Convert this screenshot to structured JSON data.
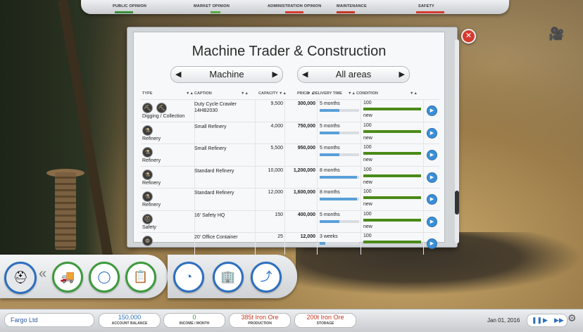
{
  "top_bar": {
    "items": [
      {
        "label": "PUBLIC OPINION",
        "color": "#3b8f3b"
      },
      {
        "label": "MARKET OPINION",
        "color": "#5aa845"
      },
      {
        "label": "ADMINISTRATION OPINION",
        "color": "#d63a2f"
      },
      {
        "label": "MAINTENANCE",
        "color": "#c8341f"
      },
      {
        "label": "SAFETY",
        "color": "#d63a2f"
      }
    ]
  },
  "window": {
    "title": "Machine Trader & Construction",
    "filter_type": "Machine",
    "filter_area": "All areas",
    "columns": [
      "TYPE",
      "CAPTION",
      "CAPACITY",
      "PRICE",
      "DELIVERY TIME",
      "CONDITION"
    ],
    "rows": [
      {
        "type": "Digging / Collection",
        "caption": "Duty Cycle Crawler 14HB2030",
        "capacity": "9,500",
        "price": "300,000",
        "delivery": "5 months",
        "delivery_fraction": 0.5,
        "condition": "100",
        "condition_status": "new",
        "condition_fraction": 1.0
      },
      {
        "type": "Refinery",
        "caption": "Small Refinery",
        "capacity": "4,000",
        "price": "750,000",
        "delivery": "5 months",
        "delivery_fraction": 0.5,
        "condition": "100",
        "condition_status": "new",
        "condition_fraction": 1.0
      },
      {
        "type": "Refinery",
        "caption": "Small Refinery",
        "capacity": "5,500",
        "price": "950,000",
        "delivery": "5 months",
        "delivery_fraction": 0.5,
        "condition": "100",
        "condition_status": "new",
        "condition_fraction": 1.0
      },
      {
        "type": "Refinery",
        "caption": "Standard Refinery",
        "capacity": "10,000",
        "price": "1,200,000",
        "delivery": "8 months",
        "delivery_fraction": 0.95,
        "condition": "100",
        "condition_status": "new",
        "condition_fraction": 1.0
      },
      {
        "type": "Refinery",
        "caption": "Standard Refinery",
        "capacity": "12,000",
        "price": "1,600,000",
        "delivery": "8 months",
        "delivery_fraction": 0.95,
        "condition": "100",
        "condition_status": "new",
        "condition_fraction": 1.0
      },
      {
        "type": "Safety",
        "caption": "16' Safety HQ",
        "capacity": "150",
        "price": "400,000",
        "delivery": "5 months",
        "delivery_fraction": 0.5,
        "condition": "100",
        "condition_status": "new",
        "condition_fraction": 1.0
      },
      {
        "type": "",
        "caption": "20' Office Container",
        "capacity": "25",
        "price": "12,000",
        "delivery": "3 weeks",
        "delivery_fraction": 0.15,
        "condition": "100",
        "condition_status": "",
        "condition_fraction": 1.0
      }
    ]
  },
  "status_bar": {
    "company": "Fargo Ltd",
    "balance_value": "150,000",
    "balance_label": "ACCOUNT BALANCE",
    "income_value": "0",
    "income_label": "INCOME / MONTH",
    "production_value": "385t Iron Ore",
    "production_label": "PRODUCTION",
    "storage_value": "200t Iron Ore",
    "storage_label": "STORAGE",
    "date": "Jan 01, 2016"
  },
  "colors": {
    "income": "#3b8f3b",
    "production": "#c8341f",
    "storage": "#c8341f",
    "balance": "#2b6fbf"
  }
}
